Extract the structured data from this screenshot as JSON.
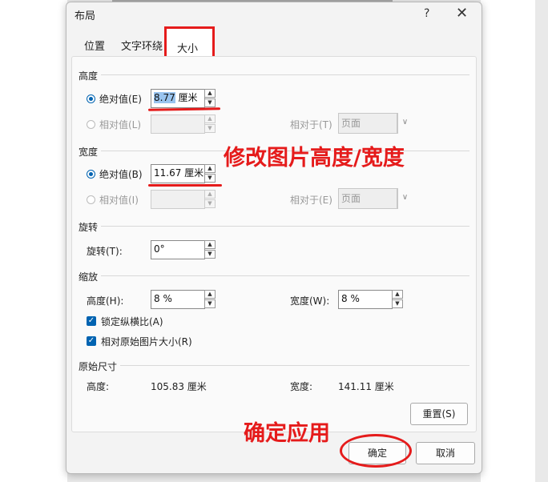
{
  "dialog": {
    "title": "布局",
    "help_label": "?",
    "close_label": "✕",
    "tabs": [
      {
        "label": "位置"
      },
      {
        "label": "文字环绕"
      },
      {
        "label": "大小"
      }
    ]
  },
  "height": {
    "section": "高度",
    "absolute_label": "绝对值(E)",
    "absolute_value": "8.77",
    "absolute_unit": "厘米",
    "relative_label": "相对值(L)",
    "relative_to_label": "相对于(T)",
    "relative_to_value": "页面"
  },
  "width": {
    "section": "宽度",
    "absolute_label": "绝对值(B)",
    "absolute_value": "11.67 厘米",
    "relative_label": "相对值(I)",
    "relative_to_label": "相对于(E)",
    "relative_to_value": "页面"
  },
  "rotate": {
    "section": "旋转",
    "label": "旋转(T):",
    "value": "0°"
  },
  "scale": {
    "section": "缩放",
    "height_label": "高度(H):",
    "height_value": "8 %",
    "width_label": "宽度(W):",
    "width_value": "8 %",
    "lock_ratio_label": "锁定纵横比(A)",
    "relative_original_label": "相对原始图片大小(R)"
  },
  "original": {
    "section": "原始尺寸",
    "height_label": "高度:",
    "height_value": "105.83 厘米",
    "width_label": "宽度:",
    "width_value": "141.11 厘米"
  },
  "buttons": {
    "reset": "重置(S)",
    "ok": "确定",
    "cancel": "取消"
  },
  "annotations": {
    "modify": "修改图片高度/宽度",
    "apply": "确定应用"
  },
  "colors": {
    "annotation": "#e51b1b",
    "accent": "#0063b1"
  }
}
